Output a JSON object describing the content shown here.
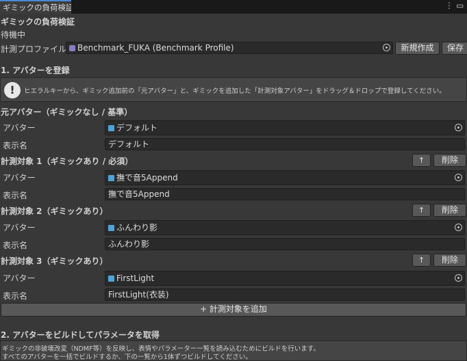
{
  "window": {
    "tab_title": "ギミックの負荷検証",
    "menu_icon": "kebab-menu-icon",
    "maximize_icon": "maximize-icon"
  },
  "header": {
    "title": "ギミックの負荷検証",
    "status": "待機中",
    "profile_label": "計測プロファイル",
    "profile_value": "Benchmark_FUKA (Benchmark Profile)",
    "new_button": "新規作成",
    "save_button": "保存"
  },
  "section1": {
    "title": "1. アバターを登録",
    "help": "ヒエラルキーから、ギミック追加前の「元アバター」と、ギミックを追加した「計測対象アバター」をドラッグ＆ドロップで登録してください。"
  },
  "labels": {
    "avatar": "アバター",
    "display_name": "表示名",
    "remove": "削除",
    "up": "↑"
  },
  "targets": [
    {
      "header": "元アバター（ギミックなし / 基準）",
      "avatar": "デフォルト",
      "name": "デフォルト"
    },
    {
      "header": "計測対象 1（ギミックあり / 必須）",
      "avatar": "撫で音5Append",
      "name": "撫で音5Append"
    },
    {
      "header": "計測対象 2（ギミックあり）",
      "avatar": "ふんわり影",
      "name": "ふんわり影"
    },
    {
      "header": "計測対象 3（ギミックあり）",
      "avatar": "FirstLight",
      "name": "FirstLight(衣装)"
    }
  ],
  "add_button": "+ 計測対象を追加",
  "section2": {
    "title": "2. アバターをビルドしてパラメータを取得",
    "line1": "ギミックの非破壊改変（NDMF等）を反映し、表情やパラメーター一覧を読み込むためにビルドを行います。",
    "line2": "すべてのアバターを一括でビルドするか、下の一覧から1体ずつビルドしてください。"
  }
}
